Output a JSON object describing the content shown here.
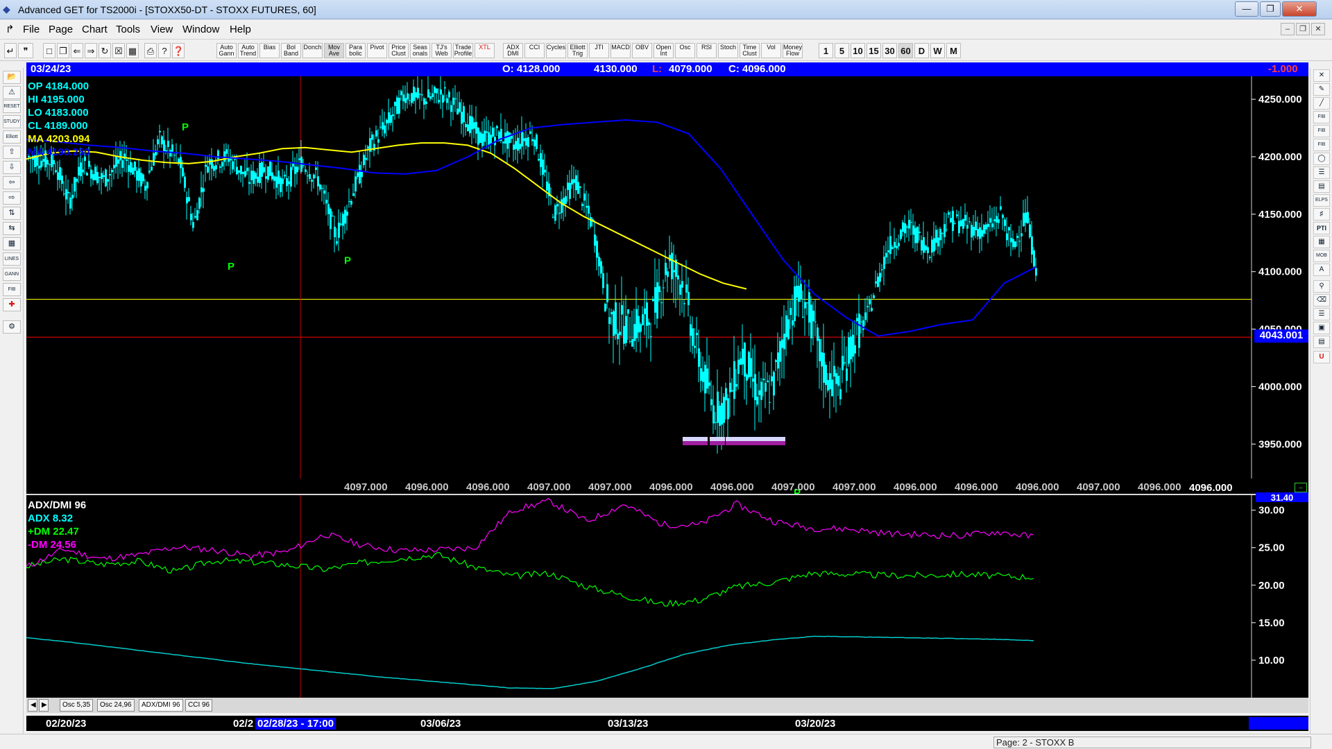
{
  "window": {
    "title": "Advanced GET for TS2000i - [STOXX50-DT - STOXX FUTURES, 60]"
  },
  "menu": [
    "File",
    "Page",
    "Chart",
    "Tools",
    "View",
    "Window",
    "Help"
  ],
  "toolbar": {
    "study_buttons": [
      "Auto Gann",
      "Auto Trend",
      "Bias",
      "Bol Band",
      "Donch",
      "Mov Ave",
      "Para bolic",
      "Pivot",
      "Price Clust",
      "Seas onals",
      "TJ's Web",
      "Trade Profile",
      "XTL",
      "ADX DMI",
      "CCI",
      "Cycles",
      "Elliott Trig",
      "JTI",
      "MACD",
      "OBV",
      "Open Int",
      "Osc",
      "RSI",
      "Stoch",
      "Time Clust",
      "Vol",
      "Money Flow"
    ],
    "timeframes": [
      "1",
      "5",
      "10",
      "15",
      "30",
      "60",
      "D",
      "W",
      "M"
    ],
    "selected_timeframe": "60",
    "selected_study": "Mov Ave"
  },
  "infobar": {
    "date": "03/24/23",
    "open": "O: 4128.000",
    "high": "4130.000",
    "low_prefix": "L:",
    "low": "4079.000",
    "close": "C: 4096.000",
    "change": "-1.000"
  },
  "legend": {
    "op": "OP  4184.000",
    "hi": "HI   4195.000",
    "lo": "LO   4183.000",
    "cl": "CL   4189.000",
    "ma1": "MA  4203.094",
    "ma2": "MA  4190.250"
  },
  "price_cursor_label": "4043.001",
  "last_price_label": "4096.000",
  "pivot_marker": "P",
  "x_values_row": [
    "4097.000",
    "4096.000",
    "4096.000",
    "4097.000",
    "4097.000",
    "4096.000",
    "4096.000",
    "4097.000",
    "4097.000",
    "4096.000",
    "4096.000",
    "4096.000",
    "4097.000",
    "4096.000"
  ],
  "indicator": {
    "name": "ADX/DMI 96",
    "adx": "ADX 8.32",
    "plus_dm": "+DM 22.47",
    "minus_dm": "-DM  24.56",
    "top_label": "31.40"
  },
  "tabs": [
    {
      "label": "Osc 5,35"
    },
    {
      "label": "Osc 24,96"
    },
    {
      "label": "ADX/DMI 96"
    },
    {
      "label": "CCI 96"
    }
  ],
  "active_tab": "ADX/DMI 96",
  "datebar": {
    "dates": [
      "02/20/23",
      "02/2",
      "03/06/23",
      "03/13/23",
      "03/20/23"
    ],
    "cursor": "02/28/23 - 17:00"
  },
  "status": {
    "page": "Page: 2 - STOXX B"
  },
  "colors": {
    "bars": "#00ffff",
    "ma_yellow": "#ffff00",
    "ma_blue": "#0000ff",
    "plus_dm": "#00ff00",
    "minus_dm": "#ff00ff",
    "adx": "#00cccc",
    "pivot": "#00ff00"
  },
  "chart_data": {
    "type": "candlestick",
    "ylim": [
      3920,
      4270
    ],
    "yticks": [
      3950,
      4000,
      4050,
      4100,
      4150,
      4200,
      4250
    ],
    "horizontal_lines": [
      {
        "value": 4076,
        "color": "#ffff00"
      },
      {
        "value": 4043,
        "color": "#ff0000"
      }
    ],
    "ma_yellow": [
      4198,
      4203,
      4205,
      4204,
      4200,
      4197,
      4195,
      4194,
      4196,
      4200,
      4203,
      4207,
      4208,
      4206,
      4204,
      4207,
      4210,
      4212,
      4212,
      4210,
      4203,
      4190,
      4175,
      4160,
      4148,
      4138,
      4128,
      4118,
      4108,
      4098,
      4090,
      4085
    ],
    "ma_blue": [
      4215,
      4213,
      4210,
      4208,
      4205,
      4203,
      4200,
      4198,
      4196,
      4193,
      4190,
      4186,
      4185,
      4188,
      4200,
      4215,
      4225,
      4228,
      4230,
      4232,
      4230,
      4220,
      4190,
      4150,
      4110,
      4080,
      4060,
      4044,
      4048,
      4054,
      4058,
      4090,
      4104
    ],
    "pivots": [
      4217,
      4115,
      4120,
      3918
    ],
    "adx_ylim": [
      5,
      32
    ],
    "adx_yticks": [
      10,
      15,
      20,
      25,
      30
    ],
    "plus_dm": [
      22.5,
      23.5,
      22.8,
      23.2,
      21.8,
      23.3,
      23.1,
      22.7,
      22.1,
      23.0,
      23.6,
      24.1,
      22.4,
      21.2,
      21.6,
      19.8,
      18.6,
      17.5,
      18.0,
      19.8,
      20.4,
      21.6,
      21.5,
      21.3,
      21.3,
      21.5,
      21.2,
      21.1
    ],
    "minus_dm": [
      22.4,
      24.8,
      23.5,
      24.0,
      25.1,
      24.7,
      23.9,
      24.5,
      26.8,
      25.3,
      24.6,
      24.7,
      25.0,
      30.0,
      31.2,
      28.5,
      30.8,
      28.1,
      28.0,
      30.8,
      28.5,
      27.6,
      27.5,
      26.9,
      26.7,
      26.6,
      27.1,
      26.4
    ],
    "adx": [
      13.0,
      12.4,
      11.7,
      11.0,
      10.3,
      9.6,
      9.0,
      8.4,
      7.8,
      7.3,
      6.8,
      6.3,
      6.2,
      7.2,
      8.9,
      10.8,
      12.0,
      12.7,
      13.2,
      13.1,
      13.0,
      12.9,
      12.8,
      12.6
    ]
  }
}
